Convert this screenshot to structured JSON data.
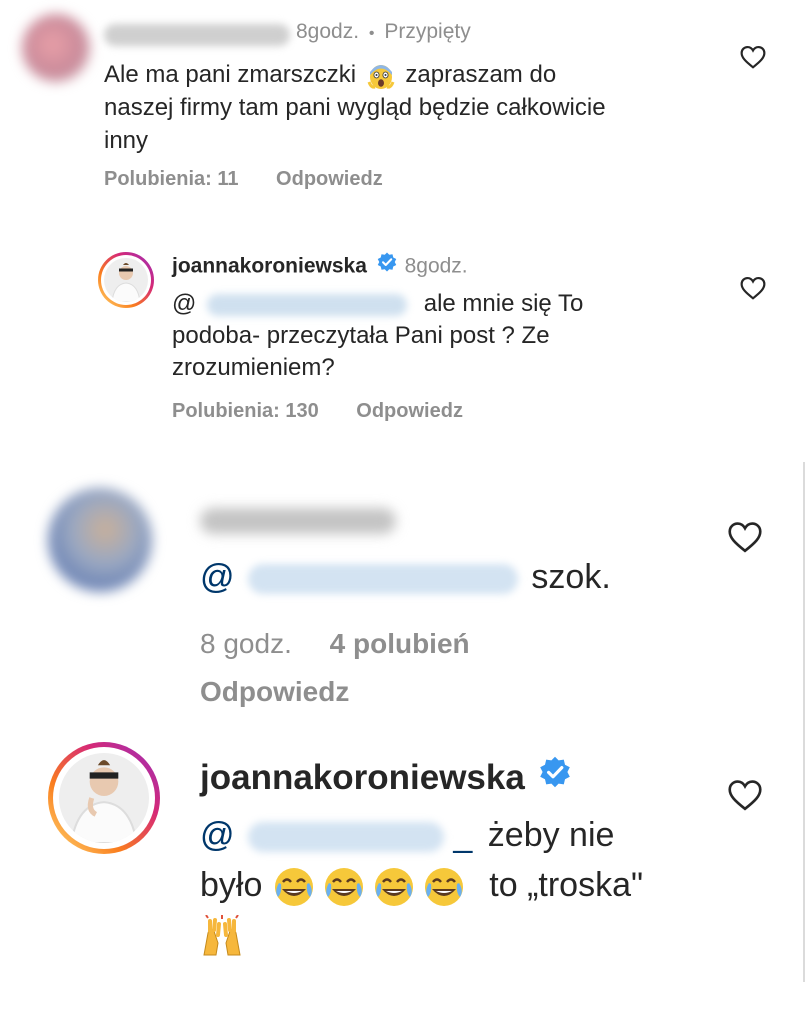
{
  "comments": [
    {
      "timestamp": "8godz.",
      "separator": "•",
      "pinned": "Przypięty",
      "text_a": "Ale ma pani zmarszczki",
      "text_b": "zapraszam do",
      "text_line2": "naszej firmy tam pani wygląd będzie całkowicie",
      "text_line3": "inny",
      "likes": "Polubienia: 11",
      "reply": "Odpowiedz",
      "emoji": "face-screaming-in-fear-icon"
    },
    {
      "username": "joannakoroniewska",
      "timestamp": "8godz.",
      "mention_prefix": "@",
      "text_line1": "ale mnie się To",
      "text_line2": "podoba- przeczytała Pani post ? Ze",
      "text_line3": "zrozumieniem?",
      "likes": "Polubienia: 130",
      "reply": "Odpowiedz"
    },
    {
      "mention_prefix": "@",
      "text": "szok.",
      "timestamp": "8 godz.",
      "likes": "4 polubień",
      "reply": "Odpowiedz"
    },
    {
      "username": "joannakoroniewska",
      "mention_prefix": "@",
      "mention_suffix": "_",
      "text_line1": "żeby nie",
      "text_line2_a": "było",
      "text_line2_b": "to „troska\"",
      "emojis": [
        "face-with-tears-of-joy-icon",
        "face-with-tears-of-joy-icon",
        "face-with-tears-of-joy-icon",
        "face-with-tears-of-joy-icon",
        "raising-hands-icon"
      ]
    }
  ],
  "colors": {
    "text": "#262626",
    "meta": "#8e8e8e",
    "verified": "#3897f0",
    "story_ring_start": "#feda75",
    "story_ring_end": "#d62976"
  }
}
